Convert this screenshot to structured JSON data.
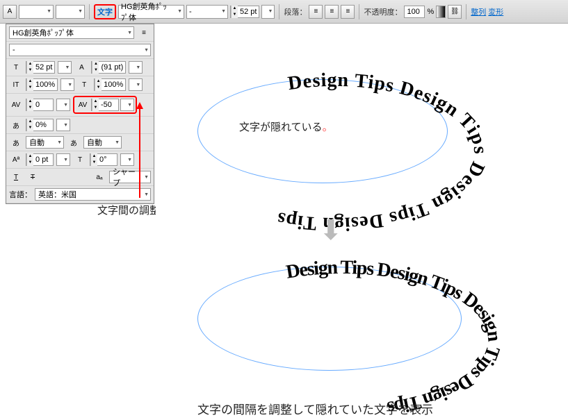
{
  "toolbar": {
    "tab_label": "文字",
    "font_family": "HG創英角ﾎﾟｯﾌﾟ体",
    "font_style": "-",
    "font_size": "52 pt",
    "paragraph_label": "段落：",
    "opacity_label": "不透明度：",
    "opacity_value": "100",
    "opacity_unit": "%",
    "align_link": "整列",
    "transform_link": "変形"
  },
  "panel": {
    "font_family": "HG創英角ﾎﾟｯﾌﾟ体",
    "font_style": "-",
    "size": "52 pt",
    "leading": "(91 pt)",
    "vscale": "100%",
    "hscale": "100%",
    "kerning": "0",
    "tracking": "-50",
    "baseline_pct": "0%",
    "auto1": "自動",
    "auto2": "自動",
    "baseline_shift": "0 pt",
    "rotation": "0°",
    "antialias": "シャープ",
    "lang_label": "言語：",
    "lang_value": "英語：米国"
  },
  "annotations": {
    "tracking_adjust": "文字間の調整",
    "hidden_text": "文字が隠れている",
    "bottom": "文字の間隔を調整して隠れていた文字を表示"
  },
  "path_text": "Design Tips Design Tips Design Tips Design Tips",
  "chart_data": null
}
